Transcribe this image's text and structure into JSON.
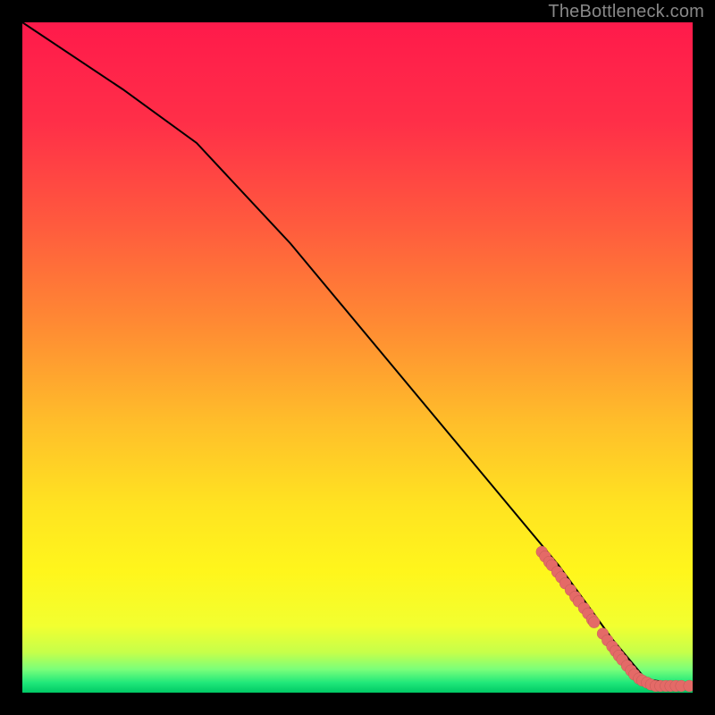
{
  "attribution": "TheBottleneck.com",
  "chart_data": {
    "type": "line",
    "title": "",
    "xlabel": "",
    "ylabel": "",
    "xlim": [
      0,
      100
    ],
    "ylim": [
      0,
      100
    ],
    "background": {
      "type": "vertical-gradient",
      "stops": [
        {
          "pos": 0.0,
          "color": "#ff1a4b"
        },
        {
          "pos": 0.15,
          "color": "#ff2f48"
        },
        {
          "pos": 0.3,
          "color": "#ff5a3e"
        },
        {
          "pos": 0.45,
          "color": "#ff8a33"
        },
        {
          "pos": 0.6,
          "color": "#ffbf2a"
        },
        {
          "pos": 0.72,
          "color": "#ffe321"
        },
        {
          "pos": 0.82,
          "color": "#fff61c"
        },
        {
          "pos": 0.9,
          "color": "#f2ff30"
        },
        {
          "pos": 0.94,
          "color": "#c6ff4a"
        },
        {
          "pos": 0.965,
          "color": "#7bff7a"
        },
        {
          "pos": 0.985,
          "color": "#20e87a"
        },
        {
          "pos": 1.0,
          "color": "#00c965"
        }
      ]
    },
    "curve": {
      "comment": "Black line: starts top-left, bends around the early region, then descends roughly linearly to the bottom-right where the green band is.",
      "points": [
        {
          "x": 0,
          "y": 100
        },
        {
          "x": 15,
          "y": 90
        },
        {
          "x": 26,
          "y": 82
        },
        {
          "x": 40,
          "y": 67
        },
        {
          "x": 55,
          "y": 49
        },
        {
          "x": 70,
          "y": 31
        },
        {
          "x": 80,
          "y": 19
        },
        {
          "x": 88,
          "y": 8
        },
        {
          "x": 93,
          "y": 2
        },
        {
          "x": 100,
          "y": 1
        }
      ]
    },
    "scatter": {
      "name": "bottleneck-points",
      "color": "#e46a67",
      "radius": 6.5,
      "points": [
        {
          "x": 77.5,
          "y": 21
        },
        {
          "x": 78.0,
          "y": 20.3
        },
        {
          "x": 78.6,
          "y": 19.5
        },
        {
          "x": 79.0,
          "y": 19
        },
        {
          "x": 79.8,
          "y": 18
        },
        {
          "x": 80.4,
          "y": 17.2
        },
        {
          "x": 81.0,
          "y": 16.3
        },
        {
          "x": 81.8,
          "y": 15.3
        },
        {
          "x": 82.5,
          "y": 14.3
        },
        {
          "x": 83.0,
          "y": 13.6
        },
        {
          "x": 83.8,
          "y": 12.6
        },
        {
          "x": 84.4,
          "y": 11.8
        },
        {
          "x": 85.0,
          "y": 10.9
        },
        {
          "x": 85.3,
          "y": 10.5
        },
        {
          "x": 86.6,
          "y": 8.8
        },
        {
          "x": 87.3,
          "y": 7.8
        },
        {
          "x": 88.0,
          "y": 6.9
        },
        {
          "x": 88.5,
          "y": 6.2
        },
        {
          "x": 89.0,
          "y": 5.5
        },
        {
          "x": 89.5,
          "y": 4.9
        },
        {
          "x": 90.2,
          "y": 4.0
        },
        {
          "x": 90.8,
          "y": 3.3
        },
        {
          "x": 91.3,
          "y": 2.7
        },
        {
          "x": 92.0,
          "y": 2.1
        },
        {
          "x": 92.5,
          "y": 1.8
        },
        {
          "x": 93.2,
          "y": 1.5
        },
        {
          "x": 93.8,
          "y": 1.2
        },
        {
          "x": 94.5,
          "y": 1.0
        },
        {
          "x": 95.2,
          "y": 1.0
        },
        {
          "x": 96.0,
          "y": 1.0
        },
        {
          "x": 96.7,
          "y": 1.0
        },
        {
          "x": 97.5,
          "y": 1.0
        },
        {
          "x": 98.3,
          "y": 1.0
        },
        {
          "x": 99.5,
          "y": 1.0
        },
        {
          "x": 101.0,
          "y": 1.0
        }
      ]
    }
  }
}
